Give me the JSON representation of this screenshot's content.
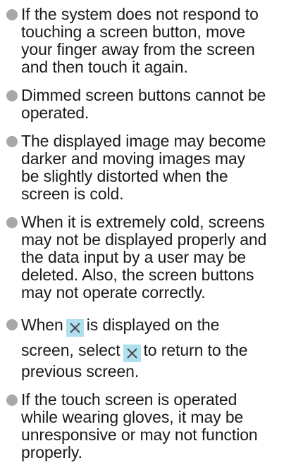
{
  "colors": {
    "text": "#1a1a1a",
    "bullet": "#a8a8a8",
    "close_button_bg": "#aee0ef",
    "close_icon": "#4a4a4a"
  },
  "notes": [
    {
      "lines": [
        "If the system does not respond to",
        "touching a screen button, move",
        "your finger away from the screen",
        "and then touch it again."
      ]
    },
    {
      "lines": [
        "Dimmed screen buttons cannot be",
        "operated."
      ]
    },
    {
      "lines": [
        "The displayed image may become",
        "darker and moving images may",
        "be slightly distorted when the",
        "screen is cold."
      ]
    },
    {
      "lines": [
        "When it is extremely cold, screens",
        "may not be displayed properly and",
        "the data input by a user may be",
        "deleted. Also, the screen buttons",
        "may not operate correctly."
      ]
    },
    {
      "line1_before": "When",
      "line1_after": "is displayed on the",
      "line2_before": "screen, select",
      "line2_after": "to return to the",
      "line3": "previous screen.",
      "icon": "close-icon"
    },
    {
      "lines": [
        "If the touch screen is operated",
        "while wearing gloves, it may be",
        "unresponsive or may not function",
        "properly."
      ]
    }
  ]
}
